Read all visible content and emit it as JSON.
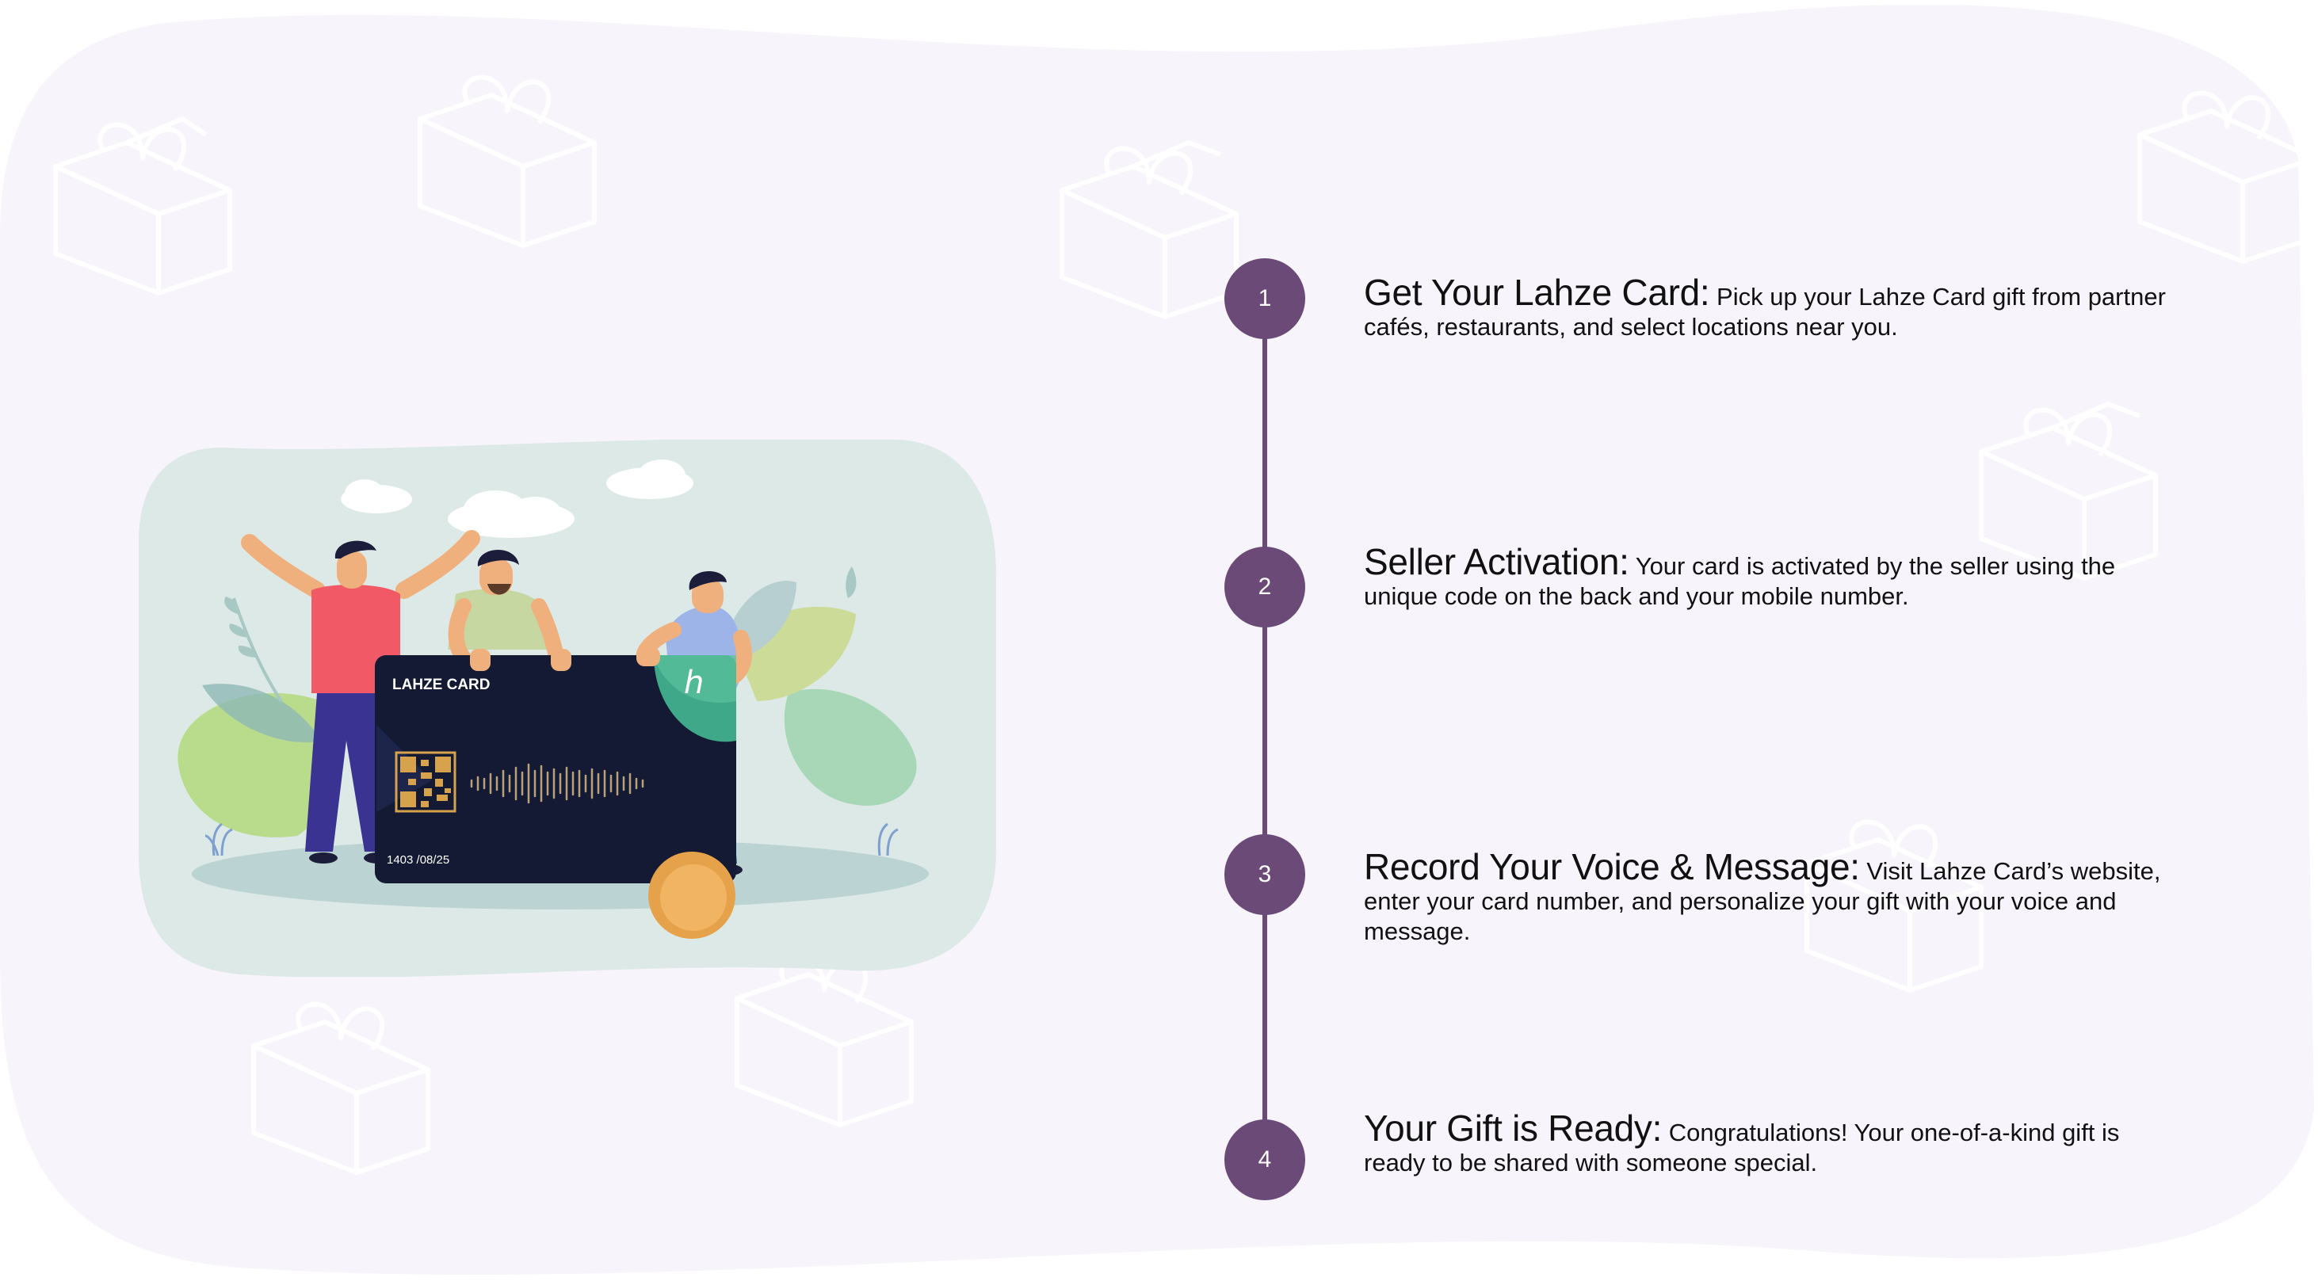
{
  "card": {
    "brand": "LAHZE CARD",
    "date": "1403 /08/25",
    "logo_glyph": "ℎ"
  },
  "colors": {
    "accent": "#6b4a78",
    "page_bg": "#f7f4fb",
    "card_bg": "#141a33",
    "scene_bg": "#dde9e6"
  },
  "steps": [
    {
      "number": "1",
      "title": "Get Your Lahze Card:",
      "body": "Pick up your Lahze Card gift from partner cafés, restaurants, and select locations near you."
    },
    {
      "number": "2",
      "title": "Seller Activation:",
      "body": "Your card is activated by the seller using the unique code on the back and your mobile number."
    },
    {
      "number": "3",
      "title": "Record Your Voice & Message:",
      "body": "Visit Lahze Card’s website, enter your card number, and personalize your gift with your voice and message."
    },
    {
      "number": "4",
      "title": "Your Gift is Ready:",
      "body": "Congratulations! Your one-of-a-kind gift is ready to be shared with someone special."
    }
  ]
}
